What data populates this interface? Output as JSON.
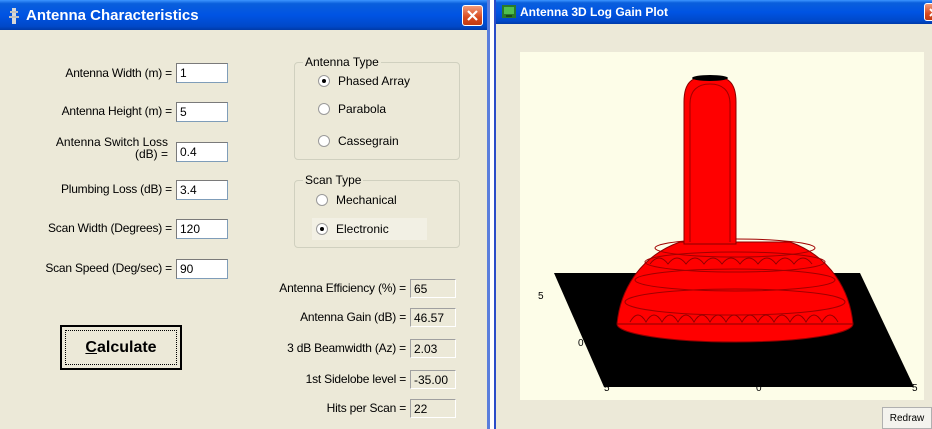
{
  "characteristics_window": {
    "title": "Antenna Characteristics",
    "fields": {
      "width": {
        "label": "Antenna Width (m) =",
        "value": "1"
      },
      "height": {
        "label": "Antenna Height (m) =",
        "value": "5"
      },
      "switch_loss": {
        "label_line1": "Antenna Switch Loss",
        "label_line2": "(dB) =",
        "value": "0.4"
      },
      "plumbing_loss": {
        "label": "Plumbing Loss (dB) =",
        "value": "3.4"
      },
      "scan_width": {
        "label": "Scan Width (Degrees) =",
        "value": "120"
      },
      "scan_speed": {
        "label": "Scan Speed (Deg/sec) =",
        "value": "90"
      }
    },
    "antenna_type": {
      "legend": "Antenna Type",
      "options": [
        "Phased Array",
        "Parabola",
        "Cassegrain"
      ],
      "selected": "Phased Array"
    },
    "scan_type": {
      "legend": "Scan Type",
      "options": [
        "Mechanical",
        "Electronic"
      ],
      "selected": "Electronic"
    },
    "results": {
      "efficiency": {
        "label": "Antenna Efficiency (%) =",
        "value": "65"
      },
      "gain": {
        "label": "Antenna Gain (dB) =",
        "value": "46.57"
      },
      "beamwidth": {
        "label": "3 dB Beamwidth (Az) =",
        "value": "2.03"
      },
      "sidelobe": {
        "label": "1st Sidelobe level =",
        "value": "-35.00"
      },
      "hits": {
        "label": "Hits per Scan =",
        "value": "22"
      }
    },
    "calculate_button": {
      "first_letter": "C",
      "rest": "alculate"
    }
  },
  "plot_window": {
    "title": "Antenna 3D Log Gain Plot",
    "axis_labels": {
      "left_top": "5",
      "left_mid": "0",
      "bottom_left": "5",
      "bottom_mid": "0",
      "bottom_right": "5"
    },
    "redraw_label": "Redraw"
  },
  "colors": {
    "title_bar": "#0054e3",
    "surface": "#ff0000",
    "floor": "#000000",
    "plot_bg": "#fdfde8",
    "window_bg": "#ece9d8"
  }
}
